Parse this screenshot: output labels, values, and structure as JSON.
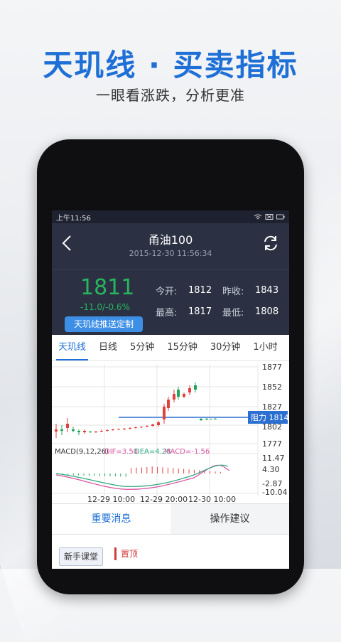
{
  "headline": "天玑线 · 买卖指标",
  "subline": "一眼看涨跌，分析更准",
  "status": {
    "time": "上午11:56"
  },
  "nav": {
    "title": "甬油100",
    "datetime": "2015-12-30 11:56:34"
  },
  "quote": {
    "price": "1811",
    "change": "-11.0/-0.6%",
    "push_button": "天玑线推送定制",
    "open_label": "今开:",
    "open": "1812",
    "prev_close_label": "昨收:",
    "prev_close": "1843",
    "high_label": "最高:",
    "high": "1817",
    "low_label": "最低:",
    "low": "1808"
  },
  "tabs": [
    "天玑线",
    "日线",
    "5分钟",
    "15分钟",
    "30分钟",
    "1小时"
  ],
  "chart": {
    "price_ticks": [
      "1877",
      "1852",
      "1827",
      "1802",
      "1777"
    ],
    "resistance_label": "阻力 1814",
    "macd_title": "MACD(9,12,26)",
    "dif": "DIF=3.50",
    "dea": "DEA=4.28",
    "macd": "MACD=-1.56",
    "macd_ticks": [
      "11.47",
      "4.30",
      "-2.87",
      "-10.04"
    ],
    "x_ticks": [
      "12-29 10:00",
      "12-29 20:00",
      "12-30 10:00"
    ],
    "colors": {
      "up": "#e2403f",
      "down": "#1fa65a",
      "resistance": "#2b6fd1",
      "dif": "#d94fa0",
      "dea": "#2aa87a"
    }
  },
  "bottom_tabs": [
    "重要消息",
    "操作建议"
  ],
  "news": {
    "newbie": "新手课堂",
    "pinned": "置顶"
  }
}
